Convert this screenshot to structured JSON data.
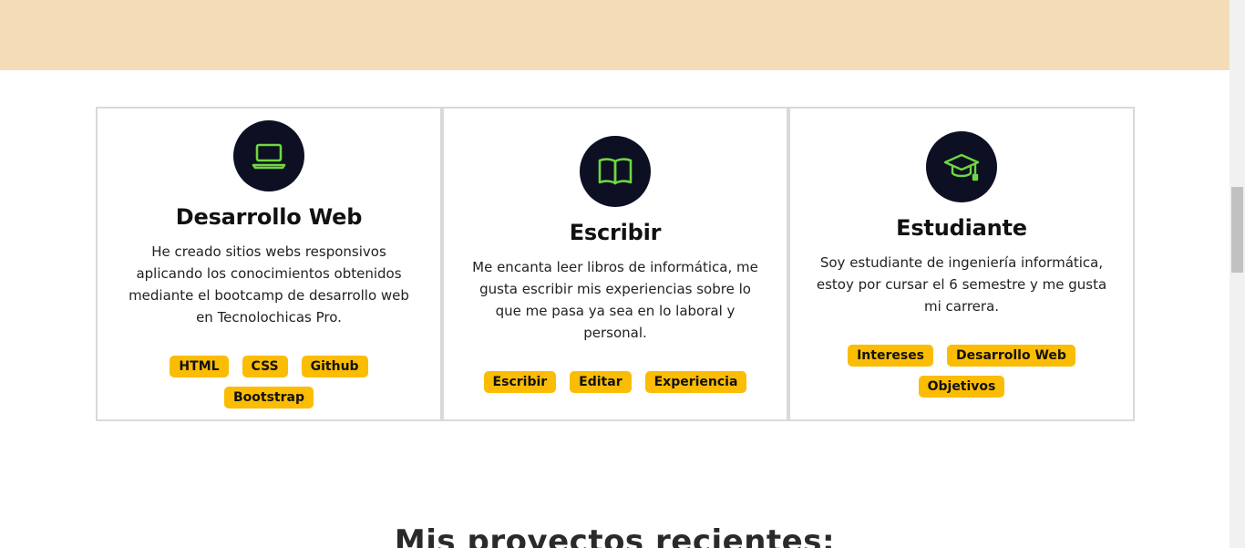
{
  "cards": [
    {
      "icon": "laptop-icon",
      "title": "Desarrollo Web",
      "text": "He creado sitios webs responsivos aplicando los conocimientos obtenidos mediante el bootcamp de desarrollo web en Tecnolochicas Pro.",
      "tags": [
        "HTML",
        "CSS",
        "Github",
        "Bootstrap"
      ]
    },
    {
      "icon": "book-icon",
      "title": "Escribir",
      "text": "Me encanta leer libros de informática, me gusta escribir mis experiencias sobre lo que me pasa ya sea en lo laboral y personal.",
      "tags": [
        "Escribir",
        "Editar",
        "Experiencia"
      ]
    },
    {
      "icon": "graduation-cap-icon",
      "title": "Estudiante",
      "text": "Soy estudiante de ingeniería informática, estoy por cursar el 6 semestre y me gusta mi carrera.",
      "tags": [
        "Intereses",
        "Desarrollo Web",
        "Objetivos"
      ]
    }
  ],
  "projects": {
    "heading": "Mis proyectos recientes:"
  },
  "colors": {
    "top_band": "#f4ddb6",
    "icon_bg": "#0d0f22",
    "icon_stroke": "#6fd640",
    "tag_bg": "#fbbc04"
  }
}
